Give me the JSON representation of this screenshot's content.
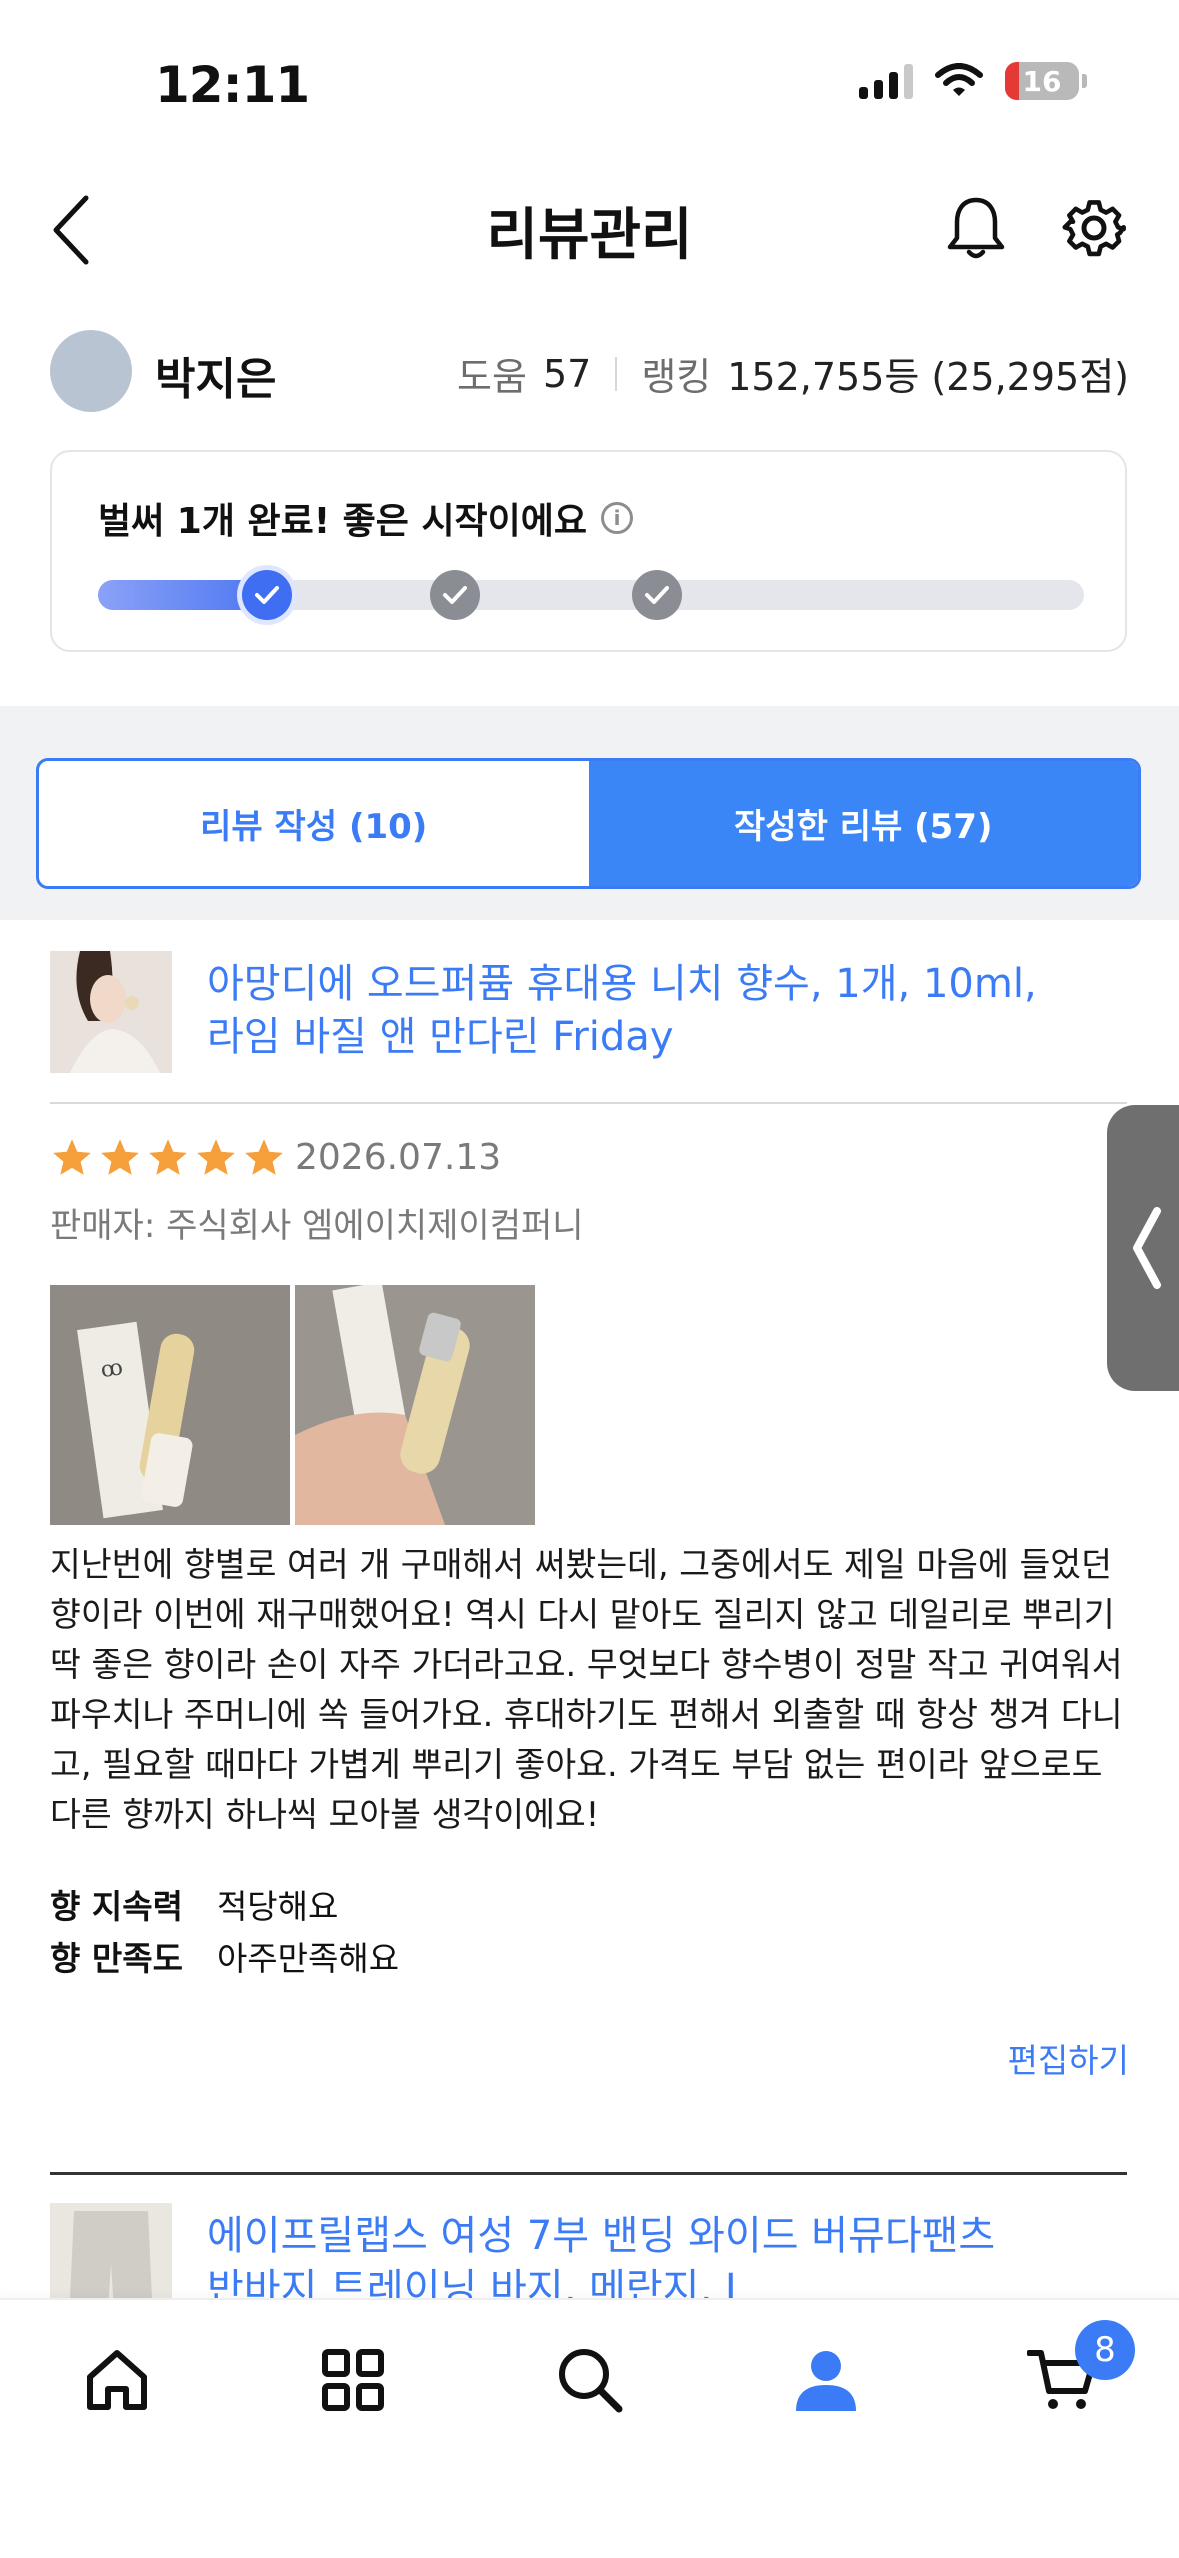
{
  "status_bar": {
    "time": "12:11",
    "battery": "16"
  },
  "header": {
    "title": "리뷰관리"
  },
  "profile": {
    "name": "박지은",
    "help_label": "도움",
    "help_count": "57",
    "ranking_label": "랭킹",
    "ranking_value": "152,755등 (25,295점)"
  },
  "progress": {
    "message": "벌써 1개 완료! 좋은 시작이에요",
    "steps_total": 3,
    "steps_completed": 1,
    "colors": {
      "done": "#3f6ef2",
      "todo": "#8a8d93"
    }
  },
  "tabs": [
    {
      "label": "리뷰 작성 (10)",
      "active": false
    },
    {
      "label": "작성한 리뷰 (57)",
      "active": true
    }
  ],
  "review": {
    "product_title_line1": "아망디에 오드퍼퓸 휴대용 니치 향수, 1개, 10ml,",
    "product_title_line2": "라임 바질 앤 만다린 Friday",
    "rating": 5,
    "date": "2026.07.13",
    "seller": "판매자: 주식회사 엠에이치제이컴퍼니",
    "body": "지난번에 향별로 여러 개 구매해서 써봤는데, 그중에서도 제일 마음에 들었던 향이라 이번에 재구매했어요!  역시 다시 맡아도 질리지 않고 데일리로 뿌리기 딱 좋은 향이라 손이 자주 가더라고요. 무엇보다 향수병이 정말 작고 귀여워서 파우치나 주머니에 쏙 들어가요. 휴대하기도 편해서 외출할 때 항상 챙겨 다니고, 필요할 때마다 가볍게 뿌리기 좋아요. 가격도 부담 없는 편이라 앞으로도 다른 향까지 하나씩 모아볼 생각이에요!",
    "attributes": [
      {
        "label": "향 지속력",
        "value": "적당해요"
      },
      {
        "label": "향 만족도",
        "value": "아주만족해요"
      }
    ],
    "edit_label": "편집하기"
  },
  "next_review": {
    "product_title_line1": "에이프릴랩스 여성 7부 밴딩 와이드 버뮤다팬츠",
    "product_title_line2": "반바지 트레이닝 바지, 메란지, L"
  },
  "bottom_nav": {
    "items": [
      "home-icon",
      "category-icon",
      "search-icon",
      "user-icon",
      "cart-icon"
    ],
    "active": "user-icon",
    "cart_badge": "8"
  },
  "colors": {
    "accent": "#3b7cf6",
    "star": "#f5a03a"
  }
}
